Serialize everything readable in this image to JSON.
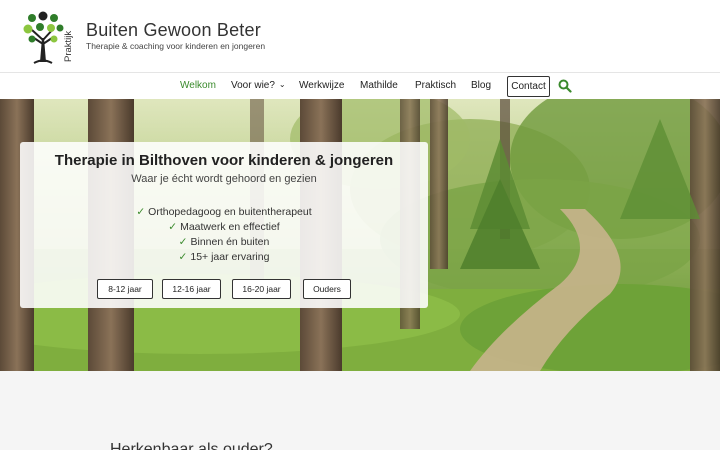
{
  "site": {
    "logo_side_text": "Praktijk",
    "title": "Buiten Gewoon Beter",
    "tagline": "Therapie & coaching voor kinderen en jongeren"
  },
  "nav": {
    "items": [
      {
        "label": "Welkom",
        "active": true
      },
      {
        "label": "Voor wie?",
        "dropdown": true
      },
      {
        "label": "Werkwijze"
      },
      {
        "label": "Mathilde"
      },
      {
        "label": "Praktisch"
      },
      {
        "label": "Blog"
      }
    ],
    "contact_label": "Contact",
    "search_icon": "search-icon",
    "active_color": "#3a8a2c"
  },
  "hero": {
    "title": "Therapie in Bilthoven voor kinderen & jongeren",
    "subtitle": "Waar je écht wordt gehoord en gezien",
    "checks": [
      "Orthopedagoog en buitentherapeut",
      "Maatwerk en effectief",
      "Binnen én buiten",
      "15+ jaar ervaring"
    ],
    "buttons": [
      "8-12 jaar",
      "12-16 jaar",
      "16-20 jaar",
      "Ouders"
    ]
  },
  "section": {
    "heading": "Herkenbaar als ouder?"
  }
}
